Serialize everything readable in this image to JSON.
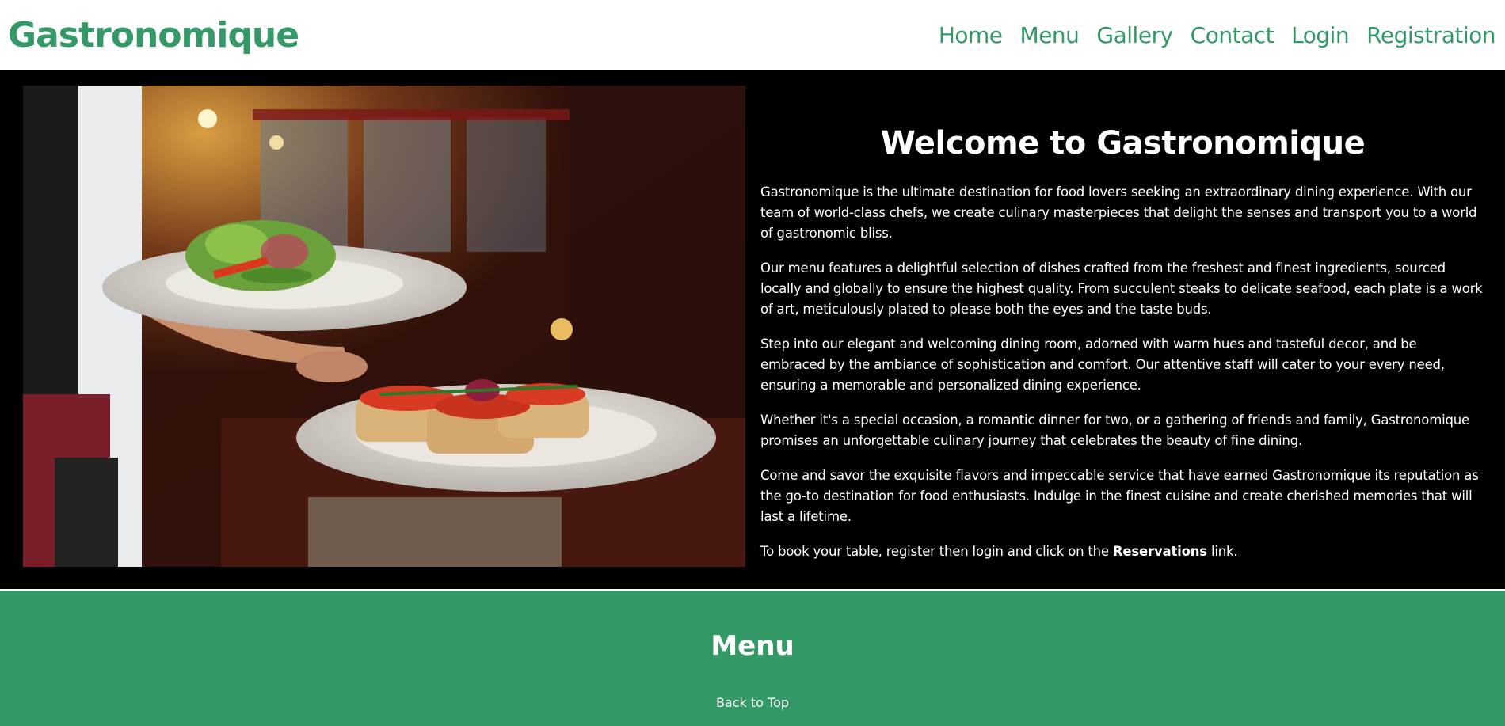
{
  "header": {
    "brand": "Gastronomique",
    "nav": [
      "Home",
      "Menu",
      "Gallery",
      "Contact",
      "Login",
      "Registration"
    ]
  },
  "hero": {
    "image_alt": "waiter-holding-plates-photo",
    "title": "Welcome to Gastronomique",
    "paragraphs": [
      "Gastronomique is the ultimate destination for food lovers seeking an extraordinary dining experience. With our team of world-class chefs, we create culinary masterpieces that delight the senses and transport you to a world of gastronomic bliss.",
      "Our menu features a delightful selection of dishes crafted from the freshest and finest ingredients, sourced locally and globally to ensure the highest quality. From succulent steaks to delicate seafood, each plate is a work of art, meticulously plated to please both the eyes and the taste buds.",
      "Step into our elegant and welcoming dining room, adorned with warm hues and tasteful decor, and be embraced by the ambiance of sophistication and comfort. Our attentive staff will cater to your every need, ensuring a memorable and personalized dining experience.",
      "Whether it's a special occasion, a romantic dinner for two, or a gathering of friends and family, Gastronomique promises an unforgettable culinary journey that celebrates the beauty of fine dining.",
      "Come and savor the exquisite flavors and impeccable service that have earned Gastronomique its reputation as the go-to destination for food enthusiasts. Indulge in the finest cuisine and create cherished memories that will last a lifetime."
    ],
    "booking_prefix": "To book your table, register then login and click on the ",
    "booking_link": "Reservations",
    "booking_suffix": " link."
  },
  "menu_section": {
    "title": "Menu",
    "back_to_top": "Back to Top"
  },
  "colors": {
    "brand_green": "#339966",
    "hero_bg": "#000000",
    "text_light": "#ffffff"
  }
}
